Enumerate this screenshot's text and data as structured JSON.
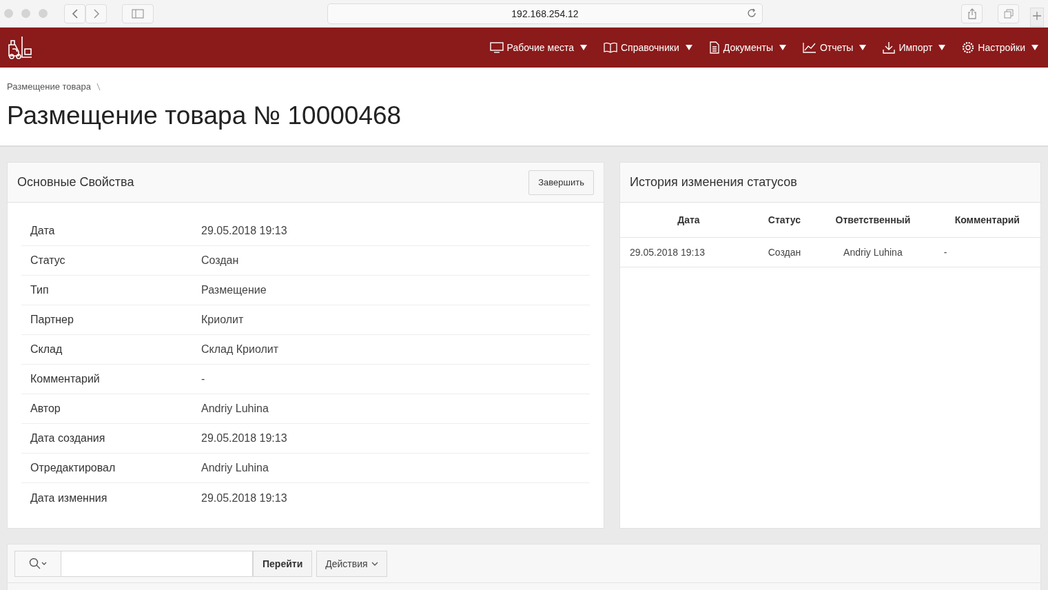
{
  "browser": {
    "address": "192.168.254.12"
  },
  "nav": {
    "items": [
      {
        "label": "Рабочие места"
      },
      {
        "label": "Справочники"
      },
      {
        "label": "Документы"
      },
      {
        "label": "Отчеты"
      },
      {
        "label": "Импорт"
      },
      {
        "label": "Настройки"
      }
    ]
  },
  "breadcrumb": [
    "Размещение товара"
  ],
  "page_title": "Размещение товара № 10000468",
  "properties": {
    "title": "Основные Свойства",
    "button": "Завершить",
    "rows": [
      {
        "label": "Дата",
        "value": "29.05.2018 19:13"
      },
      {
        "label": "Статус",
        "value": "Создан"
      },
      {
        "label": "Тип",
        "value": "Размещение"
      },
      {
        "label": "Партнер",
        "value": "Криолит"
      },
      {
        "label": "Склад",
        "value": "Склад Криолит"
      },
      {
        "label": "Комментарий",
        "value": "-"
      },
      {
        "label": "Автор",
        "value": "Andriy Luhina"
      },
      {
        "label": "Дата создания",
        "value": "29.05.2018 19:13"
      },
      {
        "label": "Отредактировал",
        "value": "Andriy Luhina"
      },
      {
        "label": "Дата изменния",
        "value": "29.05.2018 19:13"
      }
    ]
  },
  "history": {
    "title": "История изменения статусов",
    "columns": [
      "Дата",
      "Статус",
      "Ответственный",
      "Комментарий"
    ],
    "rows": [
      [
        "29.05.2018 19:13",
        "Создан",
        "Andriy Luhina",
        "-"
      ]
    ]
  },
  "toolbar": {
    "go_button": "Перейти",
    "actions_button": "Действия"
  }
}
